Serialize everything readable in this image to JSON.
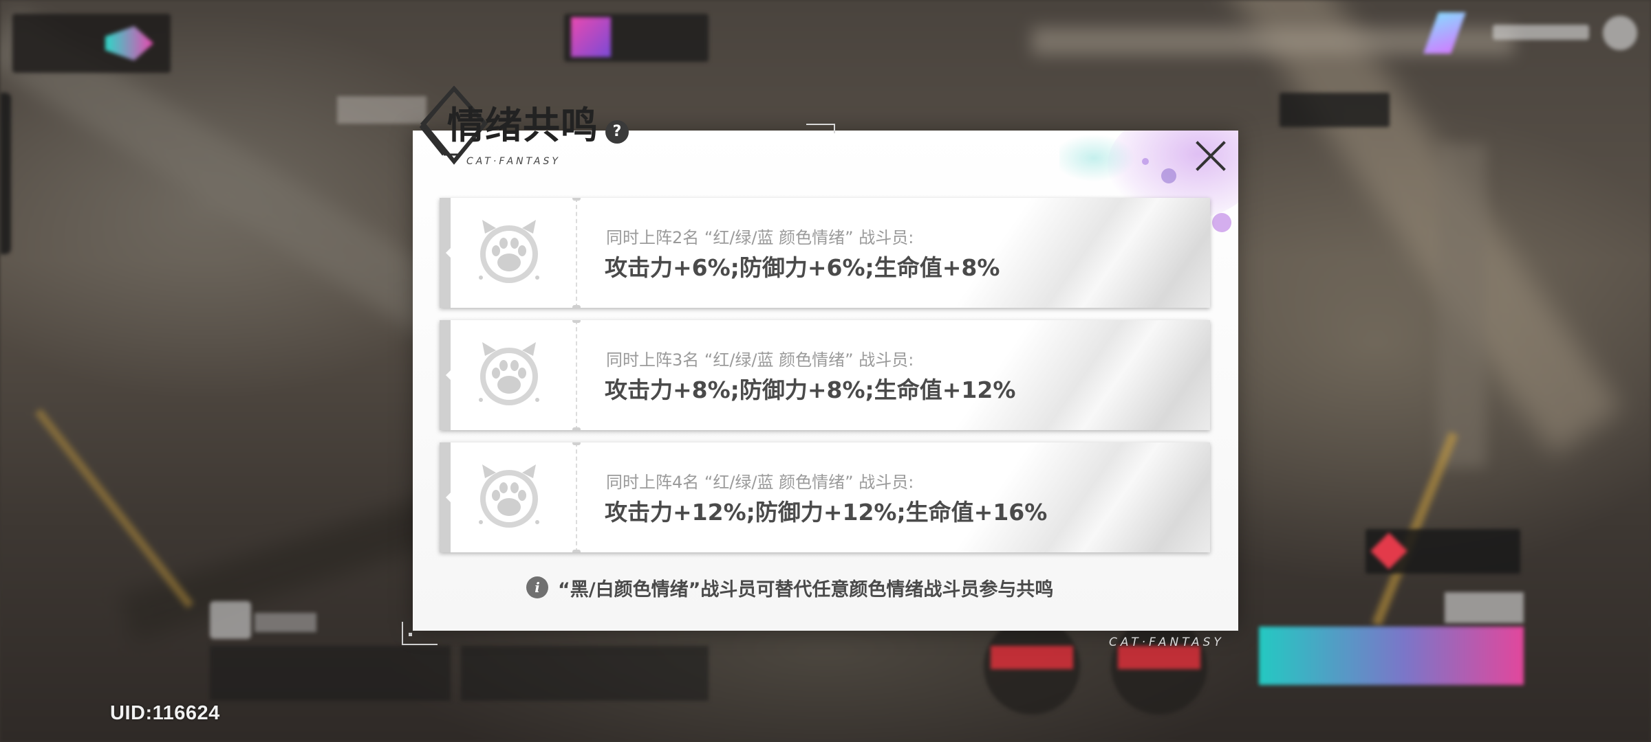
{
  "uid": "UID:116624",
  "modal": {
    "title": "情绪共鸣",
    "help": "?",
    "title_sub": "CAT·FANTASY",
    "brand_corner": "CAT·FANTASY",
    "rows": [
      {
        "condition": "同时上阵2名 “红/绿/蓝 颜色情绪” 战斗员:",
        "bonus": "攻击力+6%;防御力+6%;生命值+8%"
      },
      {
        "condition": "同时上阵3名 “红/绿/蓝 颜色情绪” 战斗员:",
        "bonus": "攻击力+8%;防御力+8%;生命值+12%"
      },
      {
        "condition": "同时上阵4名 “红/绿/蓝 颜色情绪” 战斗员:",
        "bonus": "攻击力+12%;防御力+12%;生命值+16%"
      }
    ],
    "footnote": "“黑/白颜色情绪”战斗员可替代任意颜色情绪战斗员参与共鸣",
    "info_icon": "i"
  },
  "icons": {
    "row": "cat-paw-icon",
    "close": "close-icon",
    "help": "question-icon",
    "info": "info-icon"
  },
  "colors": {
    "accent_teal": "#24c9c2",
    "accent_pink": "#e2479c",
    "accent_red": "#e33a4a"
  }
}
